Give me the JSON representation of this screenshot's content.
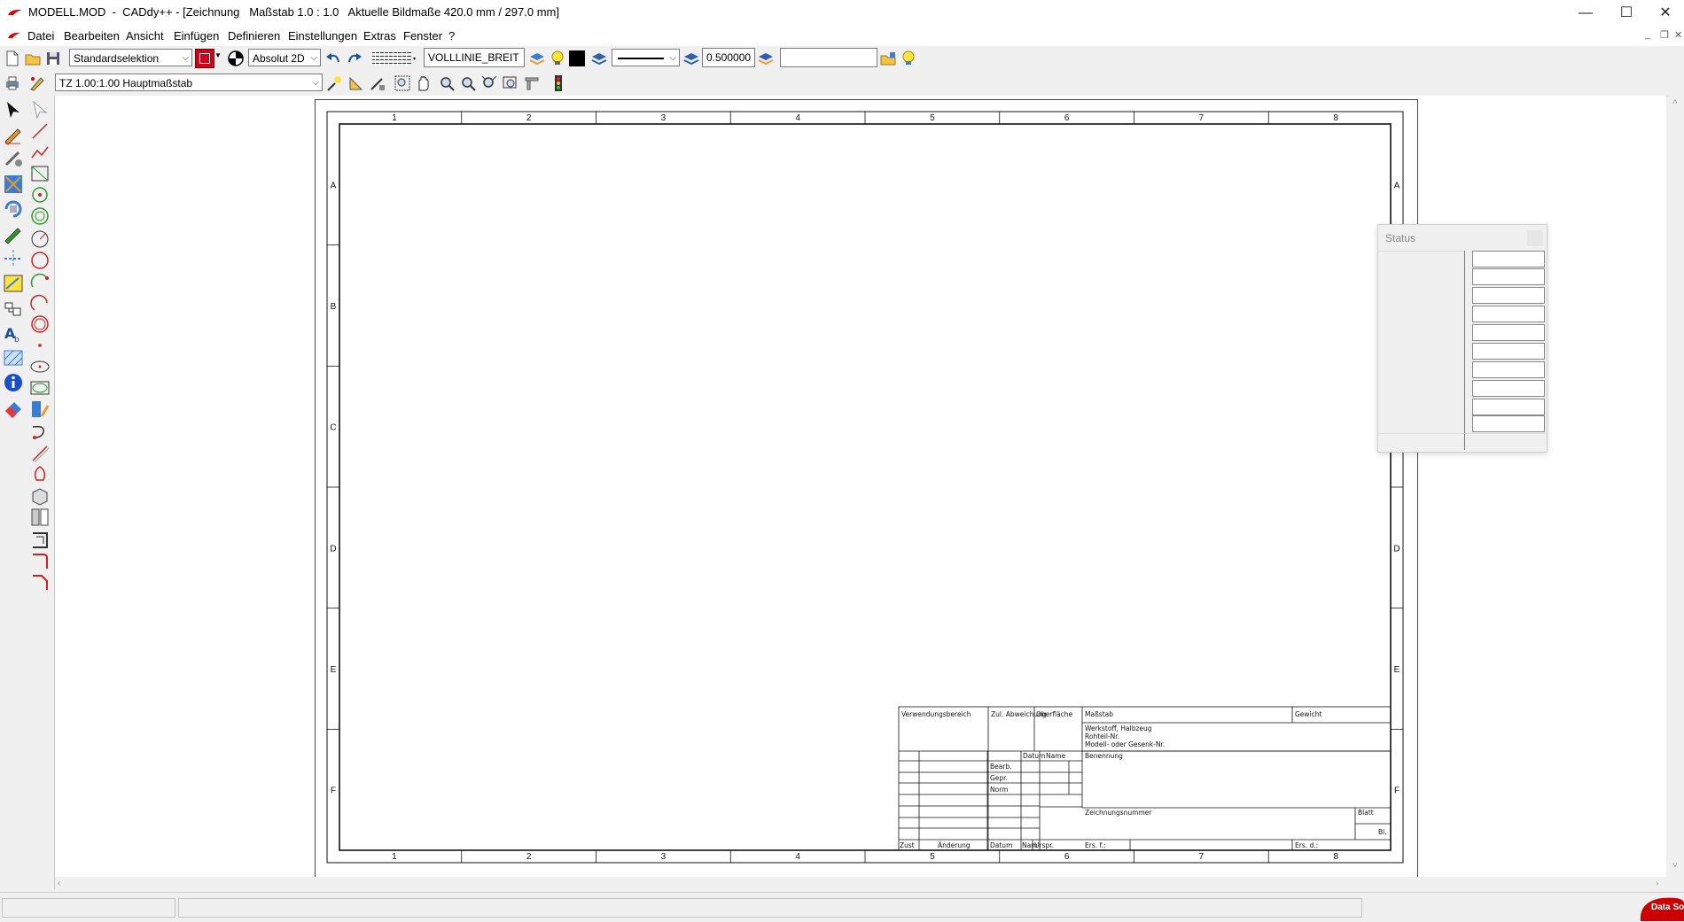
{
  "window": {
    "title": "MODELL.MOD  -  CADdy++ - [Zeichnung   Maßstab 1.0 : 1.0   Aktuelle Bildmaße 420.0 mm / 297.0 mm]",
    "minimize": "—",
    "maximize": "☐",
    "close": "✕"
  },
  "menu": {
    "items": [
      "Datei",
      "Bearbeiten",
      "Ansicht",
      "Einfügen",
      "Definieren",
      "Einstellungen",
      "Extras",
      "Fenster",
      "?"
    ],
    "mdi_minimize": "_",
    "mdi_restore": "❐",
    "mdi_close": "✕"
  },
  "toolbar1": {
    "selection_mode": "Standardselektion",
    "coord_mode": "Absolut 2D",
    "layer_name": "VOLLLINIE_BREIT",
    "line_width": "0.500000",
    "color_accent": "#000000"
  },
  "toolbar2": {
    "view_combo": "TZ 1.00:1.00 Hauptmaßstab"
  },
  "sheet": {
    "columns": [
      "1",
      "2",
      "3",
      "4",
      "5",
      "6",
      "7",
      "8"
    ],
    "rows": [
      "A",
      "B",
      "C",
      "D",
      "E",
      "F"
    ]
  },
  "title_block": {
    "verwendungsbereich": "Verwendungsbereich",
    "zul_abweichung": "Zul. Abweichung",
    "oberflaeche": "Oberfläche",
    "massstab": "Maßstab",
    "gewicht": "Gewicht",
    "werkstoff": "Werkstoff, Halbzeug",
    "rohteil": "Rohteil-Nr.",
    "modell": "Modell- oder Gesenk-Nr.",
    "datum": "Datum",
    "name": "Name",
    "benennung": "Benennung",
    "bearb": "Bearb.",
    "gepr": "Gepr.",
    "norm": "Norm",
    "zeichnungsnummer": "Zeichnungsnummer",
    "blatt": "Blatt",
    "bl": "Bl.",
    "zust": "Zust",
    "aenderung": "Änderung",
    "datum2": "Datum",
    "nam": "Nam",
    "urspr": "Urspr.",
    "ers_f": "Ers. f.:",
    "ers_d": "Ers. d.:"
  },
  "status_window": {
    "title": "Status",
    "cells": [
      "",
      "",
      "",
      "",
      "",
      "",
      "",
      "",
      "",
      ""
    ]
  },
  "brand": {
    "text": "Data Solid",
    "color": "#cc0000"
  }
}
